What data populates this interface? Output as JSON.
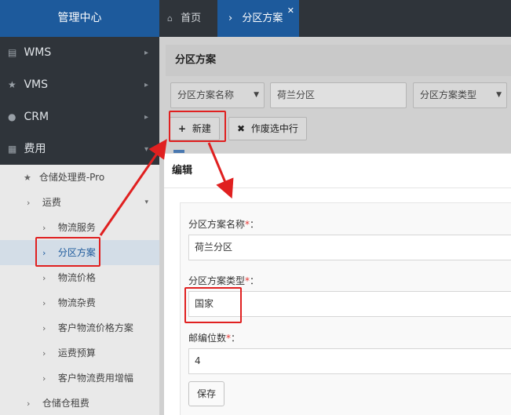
{
  "sidebar": {
    "title": "管理中心",
    "top_items": [
      {
        "label": "WMS",
        "icon": "bank-icon"
      },
      {
        "label": "VMS",
        "icon": "star-icon"
      },
      {
        "label": "CRM",
        "icon": "user-circle-icon"
      },
      {
        "label": "费用",
        "icon": "grid-icon"
      }
    ],
    "sub_items": {
      "warehouse_fee": "仓储处理费-Pro",
      "freight": "运费",
      "logistics_service": "物流服务",
      "zone_plan": "分区方案",
      "logistics_price": "物流价格",
      "logistics_misc": "物流杂费",
      "customer_price_plan": "客户物流价格方案",
      "freight_budget": "运费预算",
      "customer_fee_increase": "客户物流费用增幅",
      "warehouse_rent": "仓储仓租费"
    }
  },
  "tabs": {
    "home": "首页",
    "active": "分区方案"
  },
  "panel": {
    "title": "分区方案",
    "filter_field": "分区方案名称",
    "filter_value": "荷兰分区",
    "filter_type": "分区方案类型",
    "new_button": "新建",
    "void_button": "作废选中行"
  },
  "dialog": {
    "title": "编辑",
    "name_label": "分区方案名称",
    "name_value": "荷兰分区",
    "type_label": "分区方案类型",
    "type_value": "国家",
    "digits_label": "邮编位数",
    "digits_value": "4",
    "required_mark": "*",
    "colon": "：",
    "save_button": "保存"
  },
  "colors": {
    "accent": "#1d5a9c",
    "highlight": "#e02020"
  }
}
